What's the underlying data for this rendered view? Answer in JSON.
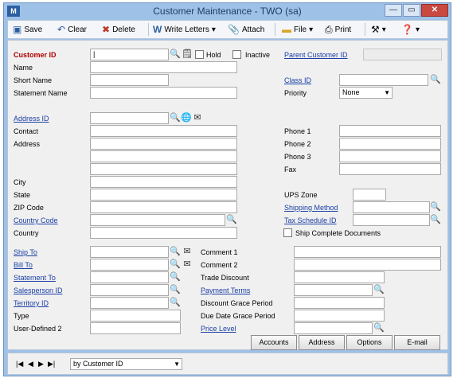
{
  "window": {
    "title": "Customer Maintenance  -  TWO (sa)",
    "app_icon": "M",
    "min": "—",
    "max": "▭",
    "close": "✕"
  },
  "toolbar": {
    "save": "Save",
    "clear": "Clear",
    "delete": "Delete",
    "write_letters": "Write Letters",
    "attach": "Attach",
    "file": "File",
    "print": "Print"
  },
  "labels": {
    "customer_id": "Customer ID",
    "hold": "Hold",
    "inactive": "Inactive",
    "parent_customer_id": "Parent Customer ID",
    "name": "Name",
    "short_name": "Short Name",
    "statement_name": "Statement Name",
    "class_id": "Class ID",
    "priority": "Priority",
    "address_id": "Address ID",
    "contact": "Contact",
    "address": "Address",
    "city": "City",
    "state": "State",
    "zip": "ZIP Code",
    "country_code": "Country Code",
    "country": "Country",
    "phone1": "Phone 1",
    "phone2": "Phone 2",
    "phone3": "Phone 3",
    "fax": "Fax",
    "ups_zone": "UPS Zone",
    "shipping_method": "Shipping Method",
    "tax_schedule_id": "Tax Schedule ID",
    "ship_complete": "Ship Complete Documents",
    "ship_to": "Ship To",
    "bill_to": "Bill To",
    "statement_to": "Statement To",
    "salesperson_id": "Salesperson ID",
    "territory_id": "Territory ID",
    "type": "Type",
    "user_defined2": "User-Defined 2",
    "comment1": "Comment 1",
    "comment2": "Comment 2",
    "trade_discount": "Trade Discount",
    "payment_terms": "Payment Terms",
    "discount_grace": "Discount Grace Period",
    "due_date_grace": "Due Date Grace Period",
    "price_level": "Price Level"
  },
  "values": {
    "customer_id": "|",
    "priority": "None"
  },
  "buttons": {
    "accounts": "Accounts",
    "address": "Address",
    "options": "Options",
    "email": "E-mail"
  },
  "status": {
    "sort": "by Customer ID"
  }
}
